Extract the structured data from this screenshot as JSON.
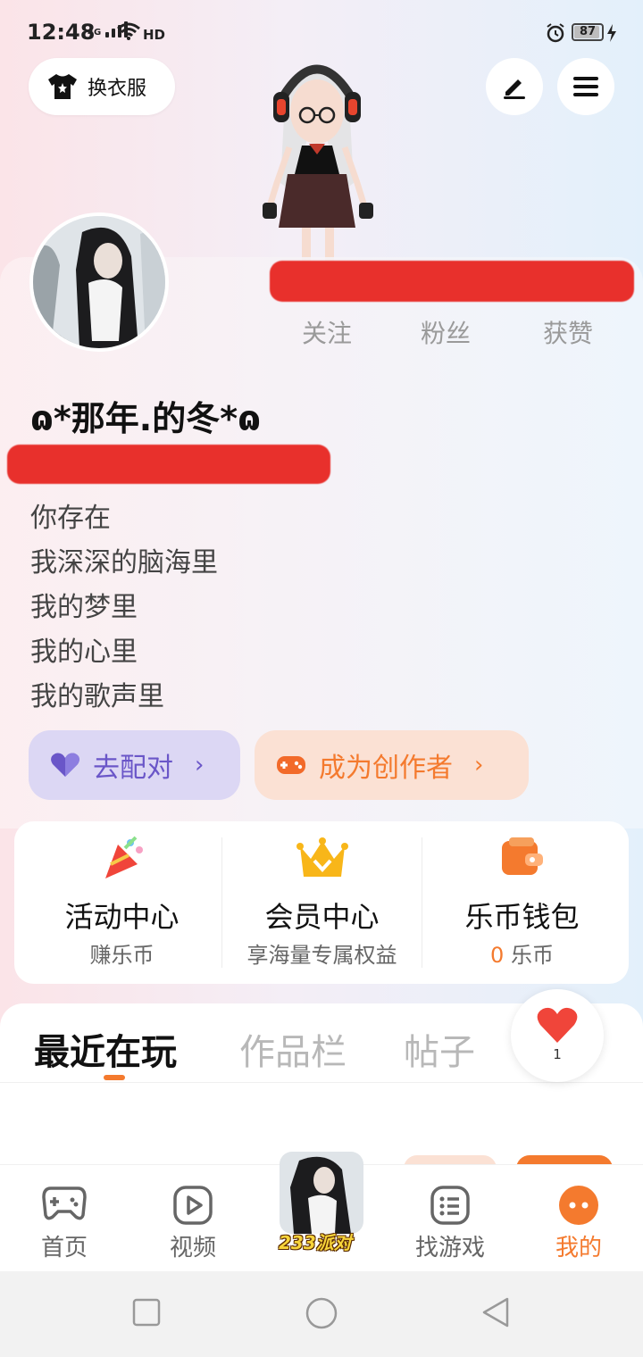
{
  "status": {
    "time": "12:48",
    "network": "4G",
    "hd": "HD",
    "battery": "87"
  },
  "top": {
    "outfit_label": "换衣服"
  },
  "profile": {
    "username": "ɷ*那年.的冬*ɷ",
    "stats": [
      "关注",
      "粉丝",
      "获赞"
    ],
    "bio": [
      "你存在",
      "我深深的脑海里",
      "我的梦里",
      "我的心里",
      "我的歌声里"
    ],
    "match_label": "去配对",
    "creator_label": "成为创作者"
  },
  "features": [
    {
      "title": "活动中心",
      "sub": "赚乐币",
      "icon": "party-popper-icon"
    },
    {
      "title": "会员中心",
      "sub": "享海量专属权益",
      "icon": "crown-icon"
    },
    {
      "title": "乐币钱包",
      "sub_value": "0",
      "sub_unit": "乐币",
      "icon": "wallet-icon"
    }
  ],
  "tabs": [
    "最近在玩",
    "作品栏",
    "帖子"
  ],
  "like": {
    "count": "1"
  },
  "nav": [
    {
      "label": "首页",
      "icon": "gamepad-icon"
    },
    {
      "label": "视频",
      "icon": "play-icon"
    },
    {
      "label": "233派对",
      "icon": "party-avatar"
    },
    {
      "label": "找游戏",
      "icon": "list-icon"
    },
    {
      "label": "我的",
      "icon": "profile-dots-icon",
      "active": true
    }
  ],
  "colors": {
    "accent": "#f47a2e",
    "match": "#6a56c8",
    "redaction": "#e8302c"
  }
}
